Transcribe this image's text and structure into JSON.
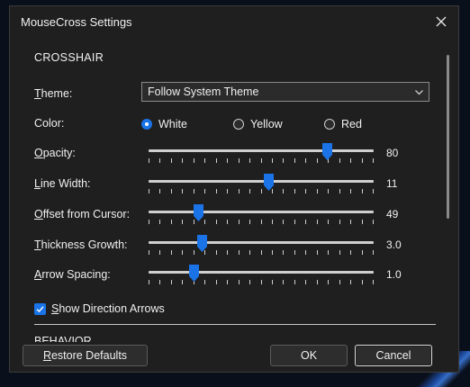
{
  "window": {
    "title": "MouseCross Settings"
  },
  "sections": {
    "crosshair": "CROSSHAIR",
    "behavior": "BEHAVIOR"
  },
  "theme": {
    "label_u": "T",
    "label_rest": "heme:",
    "selected": "Follow System Theme"
  },
  "color": {
    "label": "Color:",
    "options": [
      "White",
      "Yellow",
      "Red"
    ],
    "selected_index": 0
  },
  "sliders": [
    {
      "label_u": "O",
      "label_rest": "pacity:",
      "value": "80",
      "fraction": 0.79
    },
    {
      "label_u": "L",
      "label_rest": "ine Width:",
      "value": "11",
      "fraction": 0.53
    },
    {
      "label_u": "O",
      "label_rest": "ffset from Cursor:",
      "value": "49",
      "fraction": 0.22
    },
    {
      "label_u": "T",
      "label_rest": "hickness Growth:",
      "value": "3.0",
      "fraction": 0.235
    },
    {
      "label_u": "A",
      "label_rest": "rrow Spacing:",
      "value": "1.0",
      "fraction": 0.198
    }
  ],
  "show_arrows": {
    "label_u": "S",
    "label_rest": "how Direction Arrows",
    "checked": true
  },
  "buttons": {
    "restore_u": "R",
    "restore_rest": "estore Defaults",
    "ok": "OK",
    "cancel": "Cancel"
  },
  "colors": {
    "accent": "#1a74e8",
    "background": "#1f1f1f"
  }
}
